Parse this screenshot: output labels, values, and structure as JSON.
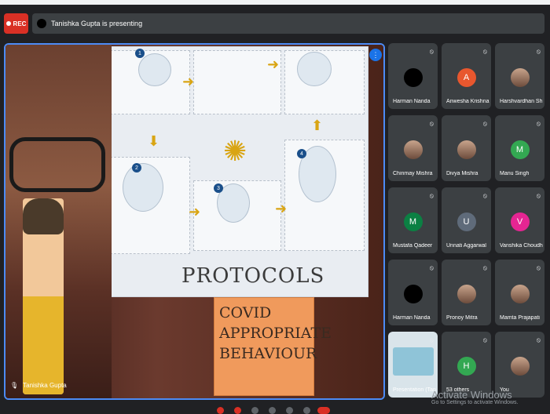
{
  "top_bar": {
    "recording_label": "REC",
    "presenting_text": "Tanishka Gupta is presenting"
  },
  "main_view": {
    "presenter_name": "Tanishka Gupta",
    "poster_heading": "PROTOCOLS",
    "sign_text": "COVID APPROPRIATE BEHAVIOUR"
  },
  "participants": [
    {
      "name": "Harman Nanda",
      "initial": "",
      "color": "#000000"
    },
    {
      "name": "Anwesha Krishna",
      "initial": "A",
      "color": "#e8572e"
    },
    {
      "name": "Harshvardhan Sh...",
      "initial": "",
      "color": "photo"
    },
    {
      "name": "Chinmay Mishra",
      "initial": "",
      "color": "photo"
    },
    {
      "name": "Divya Mishra",
      "initial": "",
      "color": "photo"
    },
    {
      "name": "Manu Singh",
      "initial": "M",
      "color": "#33a852"
    },
    {
      "name": "Mustafa Qadeer",
      "initial": "M",
      "color": "#0b8043"
    },
    {
      "name": "Unnati Aggarwal",
      "initial": "U",
      "color": "#5f6b7a"
    },
    {
      "name": "Vanshika Choudh...",
      "initial": "V",
      "color": "#e52592"
    },
    {
      "name": "Harman Nanda",
      "initial": "",
      "color": "#000000"
    },
    {
      "name": "Pronoy Mitra",
      "initial": "",
      "color": "photo"
    },
    {
      "name": "Mamta Prajapati",
      "initial": "",
      "color": "photo"
    },
    {
      "name": "Presentation (Tanishka G...",
      "initial": "",
      "color": "presentation"
    },
    {
      "name": "53 others",
      "initial": "H",
      "color": "#33a852"
    },
    {
      "name": "You",
      "initial": "",
      "color": "photo"
    }
  ],
  "watermark": {
    "title": "Activate Windows",
    "subtitle": "Go to Settings to activate Windows."
  },
  "colors": {
    "background": "#202124",
    "tile": "#3c4043",
    "rec": "#d93025",
    "active_border": "#4c8bf5"
  }
}
